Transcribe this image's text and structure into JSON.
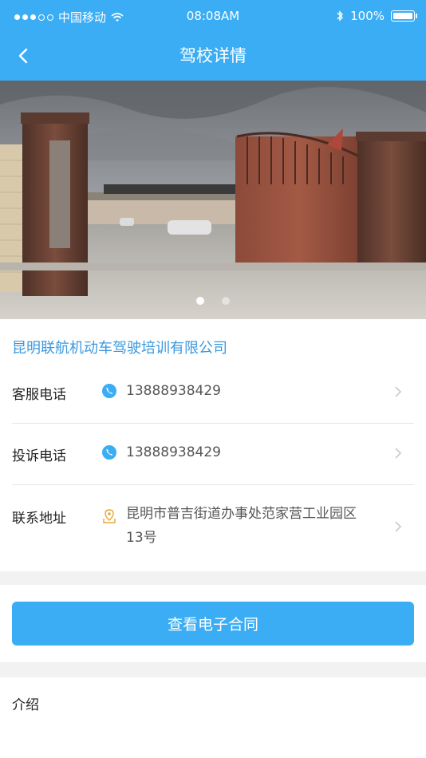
{
  "status_bar": {
    "carrier": "中国移动",
    "time": "08:08AM",
    "battery": "100%"
  },
  "nav": {
    "title": "驾校详情"
  },
  "banner": {
    "slides": 2,
    "active_index": 0
  },
  "school": {
    "name": "昆明联航机动车驾驶培训有限公司",
    "rows": [
      {
        "label": "客服电话",
        "value": "13888938429"
      },
      {
        "label": "投诉电话",
        "value": "13888938429"
      },
      {
        "label": "联系地址",
        "value_line1": "昆明市普吉街道办事处范家营工业园区",
        "value_line2": "13号"
      }
    ]
  },
  "contract_button": {
    "label": "查看电子合同"
  },
  "intro": {
    "title": "介绍"
  },
  "colors": {
    "accent": "#3badf4",
    "company_text": "#3b99df",
    "address_icon": "#e4a93a"
  },
  "icons": [
    "signal-dots-icon",
    "wifi-icon",
    "bluetooth-icon",
    "battery-icon",
    "back-icon",
    "phone-icon",
    "location-icon",
    "chevron-right-icon"
  ]
}
